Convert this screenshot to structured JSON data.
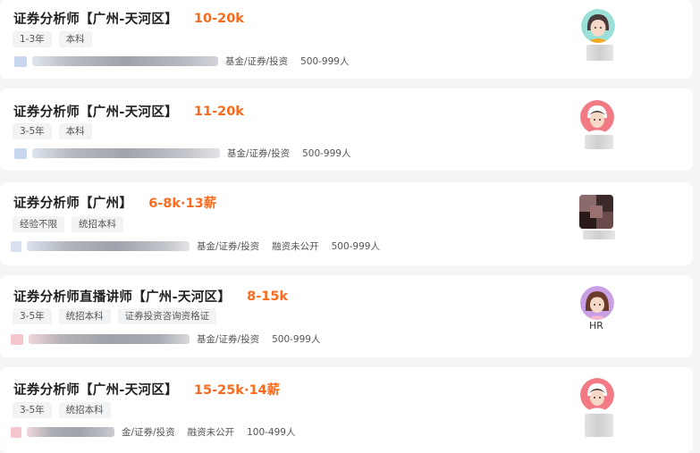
{
  "jobs": [
    {
      "title": "证券分析师【广州-天河区】",
      "salary": "10-20k",
      "tags": [
        "1-3年",
        "本科"
      ],
      "company_meta": [
        "基金/证券/投资",
        "500-999人"
      ],
      "avatar_colors": {
        "hair": "#4a3a3a",
        "face": "#f7d9c8",
        "bg": "#9be0d8"
      }
    },
    {
      "title": "证券分析师【广州-天河区】",
      "salary": "11-20k",
      "tags": [
        "3-5年",
        "本科"
      ],
      "company_meta": [
        "基金/证券/投资",
        "500-999人"
      ],
      "avatar_colors": {
        "hair": "#ffffff",
        "face": "#f7d9c8",
        "bg": "#f27a85"
      }
    },
    {
      "title": "证券分析师【广州】",
      "salary": "6-8k·13薪",
      "tags": [
        "经验不限",
        "统招本科"
      ],
      "company_meta": [
        "基金/证券/投资",
        "融资未公开",
        "500-999人"
      ],
      "avatar_colors": {
        "hair": "#3a2a2a",
        "face": "#8a6060",
        "bg": "#b08080"
      }
    },
    {
      "title": "证券分析师直播讲师【广州-天河区】",
      "salary": "8-15k",
      "tags": [
        "3-5年",
        "统招本科",
        "证券投资咨询资格证"
      ],
      "company_meta": [
        "基金/证券/投资",
        "500-999人"
      ],
      "avatar_colors": {
        "hair": "#6b3b2b",
        "face": "#f7d9c8",
        "bg": "#c9a0e6"
      },
      "hr_label": "HR"
    },
    {
      "title": "证券分析师【广州-天河区】",
      "salary": "15-25k·14薪",
      "tags": [
        "3-5年",
        "统招本科"
      ],
      "company_meta": [
        "金/证券/投资",
        "融资未公开",
        "100-499人"
      ],
      "avatar_colors": {
        "hair": "#ffffff",
        "face": "#f7d9c8",
        "bg": "#f27a85"
      }
    }
  ],
  "icons": {
    "company_logo": "company-logo-icon",
    "avatar": "recruiter-avatar-icon"
  }
}
